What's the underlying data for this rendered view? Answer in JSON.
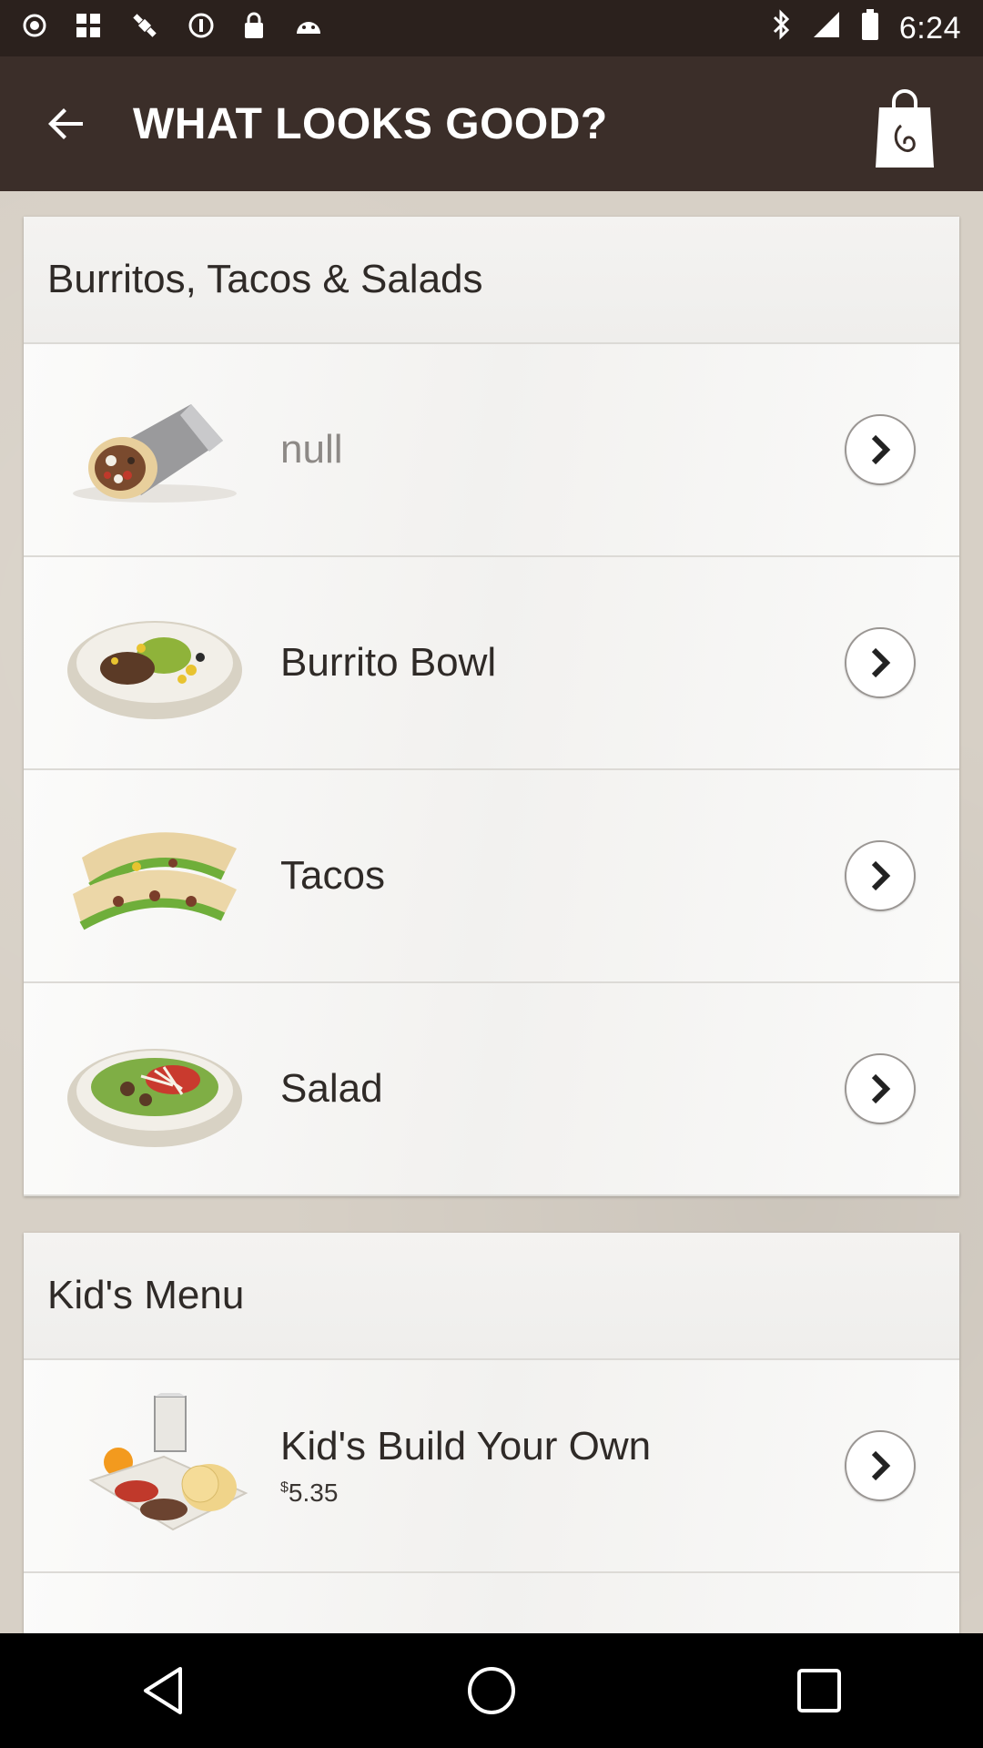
{
  "status_bar": {
    "time": "6:24",
    "left_icons": [
      "record-icon",
      "grid-icon",
      "satellite-icon",
      "alarm-icon",
      "lock-icon",
      "android-icon"
    ],
    "right_icons": [
      "bluetooth-icon",
      "signal-icon",
      "battery-icon"
    ]
  },
  "app_bar": {
    "title": "WHAT LOOKS GOOD?",
    "back_icon": "arrow-back-icon",
    "bag_icon": "shopping-bag-icon"
  },
  "sections": [
    {
      "header": "Burritos, Tacos & Salads",
      "items": [
        {
          "title": "null",
          "image": "burrito-image"
        },
        {
          "title": "Burrito Bowl",
          "image": "burrito-bowl-image"
        },
        {
          "title": "Tacos",
          "image": "tacos-image"
        },
        {
          "title": "Salad",
          "image": "salad-image"
        }
      ]
    },
    {
      "header": "Kid's Menu",
      "items": [
        {
          "title": "Kid's Build Your Own",
          "price_symbol": "$",
          "price": "5.35",
          "image": "kids-meal-image"
        }
      ]
    }
  ],
  "nav_bar": {
    "back": "nav-back-icon",
    "home": "nav-home-icon",
    "recents": "nav-recents-icon"
  },
  "colors": {
    "app_bar": "#3b2e29",
    "status_bar": "#2b211d",
    "background": "#d7d0c6",
    "card": "#f7f6f4"
  }
}
